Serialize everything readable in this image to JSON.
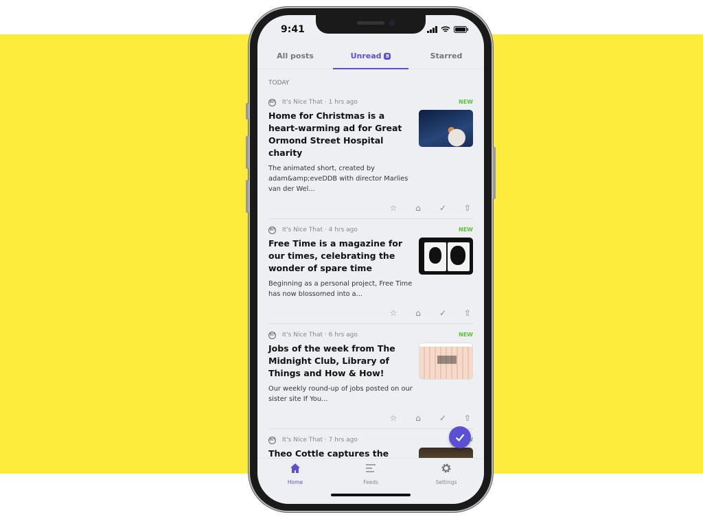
{
  "colors": {
    "background_band": "#FDEC3C",
    "accent": "#5B4FD6",
    "new_badge": "#58C439"
  },
  "status_bar": {
    "time": "9:41"
  },
  "tabs": [
    {
      "label": "All posts"
    },
    {
      "label": "Unread",
      "badge": "8",
      "active": true
    },
    {
      "label": "Starred"
    }
  ],
  "section_label": "TODAY",
  "items": [
    {
      "source": "It's Nice That · 1 hrs ago",
      "badge": "NEW",
      "title": "Home for Christmas is a heart-warming ad for Great Ormond Street Hospital charity",
      "excerpt": "The animated short, created by adam&amp;eveDDB with director Marlies van der Wel..."
    },
    {
      "source": "It's Nice That · 4 hrs ago",
      "badge": "NEW",
      "title": "Free Time is a magazine for our times, celebrating the wonder of spare time",
      "excerpt": "Beginning as a personal project, Free Time has now blossomed into a..."
    },
    {
      "source": "It's Nice That · 6 hrs ago",
      "badge": "NEW",
      "title": "Jobs of the week from The Midnight Club, Library of Things and How & How!",
      "excerpt": "Our weekly round-up of jobs posted on our sister site If You..."
    },
    {
      "source": "It's Nice That · 7 hrs ago",
      "badge": "NEW",
      "title": "Theo Cottle captures the “solemn but special” mood during a brief",
      "excerpt": ""
    }
  ],
  "item_actions": [
    "star-icon",
    "tag-icon",
    "check-icon",
    "share-icon"
  ],
  "bottom_nav": [
    {
      "label": "Home",
      "icon": "home-icon",
      "active": true
    },
    {
      "label": "Feeds",
      "icon": "feeds-icon"
    },
    {
      "label": "Settings",
      "icon": "gear-icon"
    }
  ],
  "fab": {
    "icon": "check-icon"
  }
}
